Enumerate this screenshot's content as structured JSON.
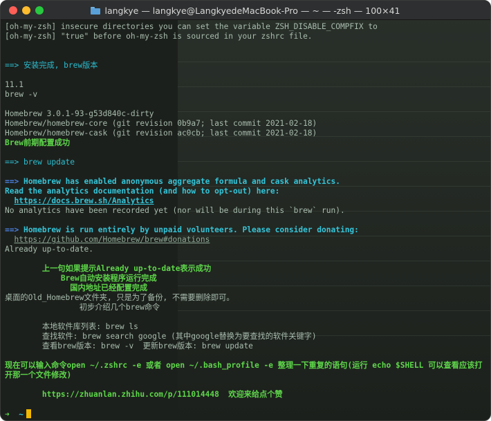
{
  "window": {
    "title": "langkye — langkye@LangkyedeMacBook-Pro — ~ — -zsh — 100×41",
    "folder_icon": "folder-icon"
  },
  "colors": {
    "background": "#1c201c",
    "plain": "#a8bcae",
    "cyan": "#2bbdd0",
    "green": "#5ed64a",
    "blue_arrow": "#4a7fe0",
    "cursor": "#f0b800"
  },
  "terminal": {
    "lines": [
      {
        "style": "plain",
        "text": "[oh-my-zsh] insecure directories you can set the variable ZSH_DISABLE_COMPFIX to"
      },
      {
        "style": "plain",
        "text": "[oh-my-zsh] \"true\" before oh-my-zsh is sourced in your zshrc file."
      },
      {
        "style": "blank",
        "text": ""
      },
      {
        "style": "blank",
        "text": ""
      },
      {
        "style": "cyan",
        "text": "==> 安装完成, brew版本"
      },
      {
        "style": "blank",
        "text": ""
      },
      {
        "style": "plain",
        "text": "11.1"
      },
      {
        "style": "plain",
        "text": "brew -v"
      },
      {
        "style": "blank",
        "text": ""
      },
      {
        "style": "plain",
        "text": "Homebrew 3.0.1-93-g53d840c-dirty"
      },
      {
        "style": "plain",
        "text": "Homebrew/homebrew-core (git revision 0b9a7; last commit 2021-02-18)"
      },
      {
        "style": "plain",
        "text": "Homebrew/homebrew-cask (git revision ac0cb; last commit 2021-02-18)"
      },
      {
        "style": "green-b",
        "text": "Brew前期配置成功"
      },
      {
        "style": "blank",
        "text": ""
      },
      {
        "style": "cyan",
        "text": "==> brew update"
      },
      {
        "style": "blank",
        "text": ""
      },
      {
        "style": "arrow-cyan",
        "arrow": "==>",
        "text": " Homebrew has enabled anonymous aggregate formula and cask analytics."
      },
      {
        "style": "cyan-b",
        "text": "Read the analytics documentation (and how to opt-out) here:"
      },
      {
        "style": "link-cyan",
        "indent": "  ",
        "text": "https://docs.brew.sh/Analytics"
      },
      {
        "style": "plain",
        "text": "No analytics have been recorded yet (nor will be during this `brew` run)."
      },
      {
        "style": "blank",
        "text": ""
      },
      {
        "style": "arrow-cyan",
        "arrow": "==>",
        "text": " Homebrew is run entirely by unpaid volunteers. Please consider donating:"
      },
      {
        "style": "link-dim",
        "indent": "  ",
        "text": "https://github.com/Homebrew/brew#donations"
      },
      {
        "style": "plain",
        "text": "Already up-to-date."
      },
      {
        "style": "blank",
        "text": ""
      },
      {
        "style": "green-b",
        "text": "        上一句如果提示Already up-to-date表示成功"
      },
      {
        "style": "green-b",
        "text": "            Brew自动安装程序运行完成"
      },
      {
        "style": "green-b",
        "text": "              国内地址已经配置完成"
      },
      {
        "style": "plain",
        "text": "桌面的Old_Homebrew文件夹, 只是为了备份, 不需要删除即可。"
      },
      {
        "style": "plain",
        "text": "                初步介绍几个brew命令"
      },
      {
        "style": "blank",
        "text": ""
      },
      {
        "style": "plain",
        "text": "        本地软件库列表: brew ls"
      },
      {
        "style": "plain",
        "text": "        查找软件: brew search google (其中google替换为要查找的软件关键字)"
      },
      {
        "style": "plain",
        "text": "        查看brew版本: brew -v  更新brew版本: brew update"
      },
      {
        "style": "blank",
        "text": ""
      },
      {
        "style": "green-wrap",
        "text": "现在可以输入命令open ~/.zshrc -e 或者 open ~/.bash_profile -e 整理一下重复的语句(运行 echo $SHELL 可以查看应该打开那一个文件修改)"
      },
      {
        "style": "blank",
        "text": ""
      },
      {
        "style": "green-b",
        "text": "        https://zhuanlan.zhihu.com/p/111014448  欢迎来给点个赞"
      },
      {
        "style": "blank",
        "text": ""
      }
    ],
    "prompt": {
      "arrow": "➜",
      "dir": "~"
    }
  }
}
